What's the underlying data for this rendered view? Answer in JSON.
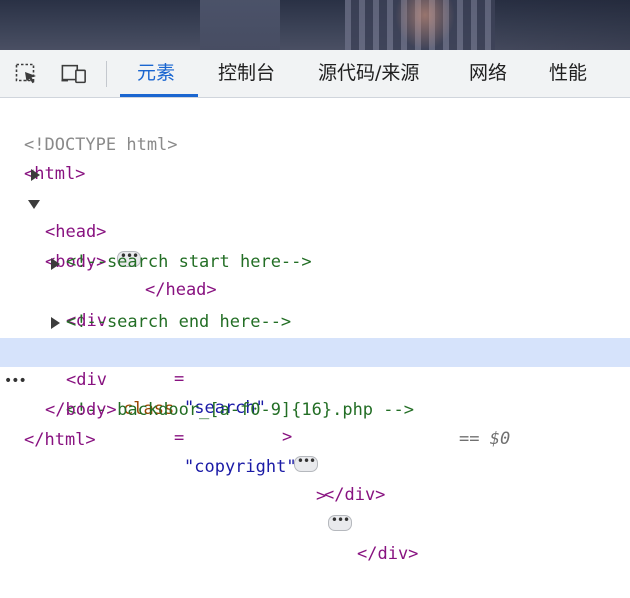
{
  "devtools": {
    "tabs": [
      {
        "label": "元素",
        "active": true
      },
      {
        "label": "控制台",
        "active": false
      },
      {
        "label": "源代码/来源",
        "active": false
      },
      {
        "label": "网络",
        "active": false
      },
      {
        "label": "性能",
        "active": false
      }
    ],
    "toolbar_icons": [
      "inspect-element-icon",
      "device-toolbar-icon"
    ],
    "accent_color": "#1a66d0"
  },
  "dom_tree": {
    "doctype": "<!DOCTYPE html>",
    "html_open": "<html>",
    "head_open": "<head>",
    "head_close": "</head>",
    "body_open": "<body>",
    "comment_search_start": "<!--search start here-->",
    "div_open_prefix": "<div ",
    "attr_class": "class",
    "attr_eq": "=",
    "search_class_value": "\"search\"",
    "tag_gt": ">",
    "div_close": "</div>",
    "comment_search_end": "<!--search end here-->",
    "copyright_class_value": "\"copyright\"",
    "comment_backdoor": "<!-- backdoor_[a-f0-9]{16}.php -->",
    "selected_marker": "== $0",
    "body_close": "</body>",
    "html_close": "</html>",
    "ellipsis": "•••",
    "gutter_ellipsis": "•••"
  }
}
